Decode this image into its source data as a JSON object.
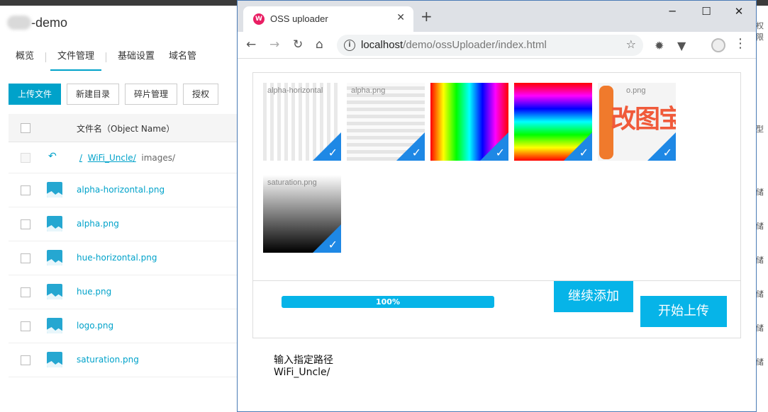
{
  "console": {
    "brand_suffix": "-demo",
    "nav_tabs": [
      "概览",
      "文件管理",
      "基础设置",
      "域名管"
    ],
    "toolbar": [
      "上传文件",
      "新建目录",
      "碎片管理",
      "授权"
    ],
    "table_header": "文件名（Object Name）",
    "path": {
      "back": "↶",
      "root": "/",
      "folder": "WiFi_Uncle/",
      "sub": "images/"
    },
    "files": [
      "alpha-horizontal.png",
      "alpha.png",
      "hue-horizontal.png",
      "hue.png",
      "logo.png",
      "saturation.png"
    ],
    "right_header": "权限",
    "right_col_header2": "型",
    "right_col_cell": "储"
  },
  "browser": {
    "tab_title": "OSS uploader",
    "url_host": "localhost",
    "url_path": "/demo/ossUploader/index.html",
    "favicon": "W"
  },
  "uploader": {
    "thumbnails": [
      {
        "label": "alpha-horizontal",
        "style": "alpha-horizontal"
      },
      {
        "label": "alpha.png",
        "style": "alpha"
      },
      {
        "label": "",
        "style": "hue-horizontal"
      },
      {
        "label": "",
        "style": "hue"
      },
      {
        "label": "o.png",
        "style": "logo"
      },
      {
        "label": "saturation.png",
        "style": "saturation"
      }
    ],
    "logo_text": "改图宝",
    "progress_text": "100%",
    "progress": 1.0,
    "continue_add": "继续添加",
    "start_upload": "开始上传",
    "path_label": "输入指定路径",
    "path_value": "WiFi_Uncle/"
  },
  "colors": {
    "accent": "#00a2ca",
    "progress": "#06b4e8",
    "check": "#1e88e5"
  }
}
